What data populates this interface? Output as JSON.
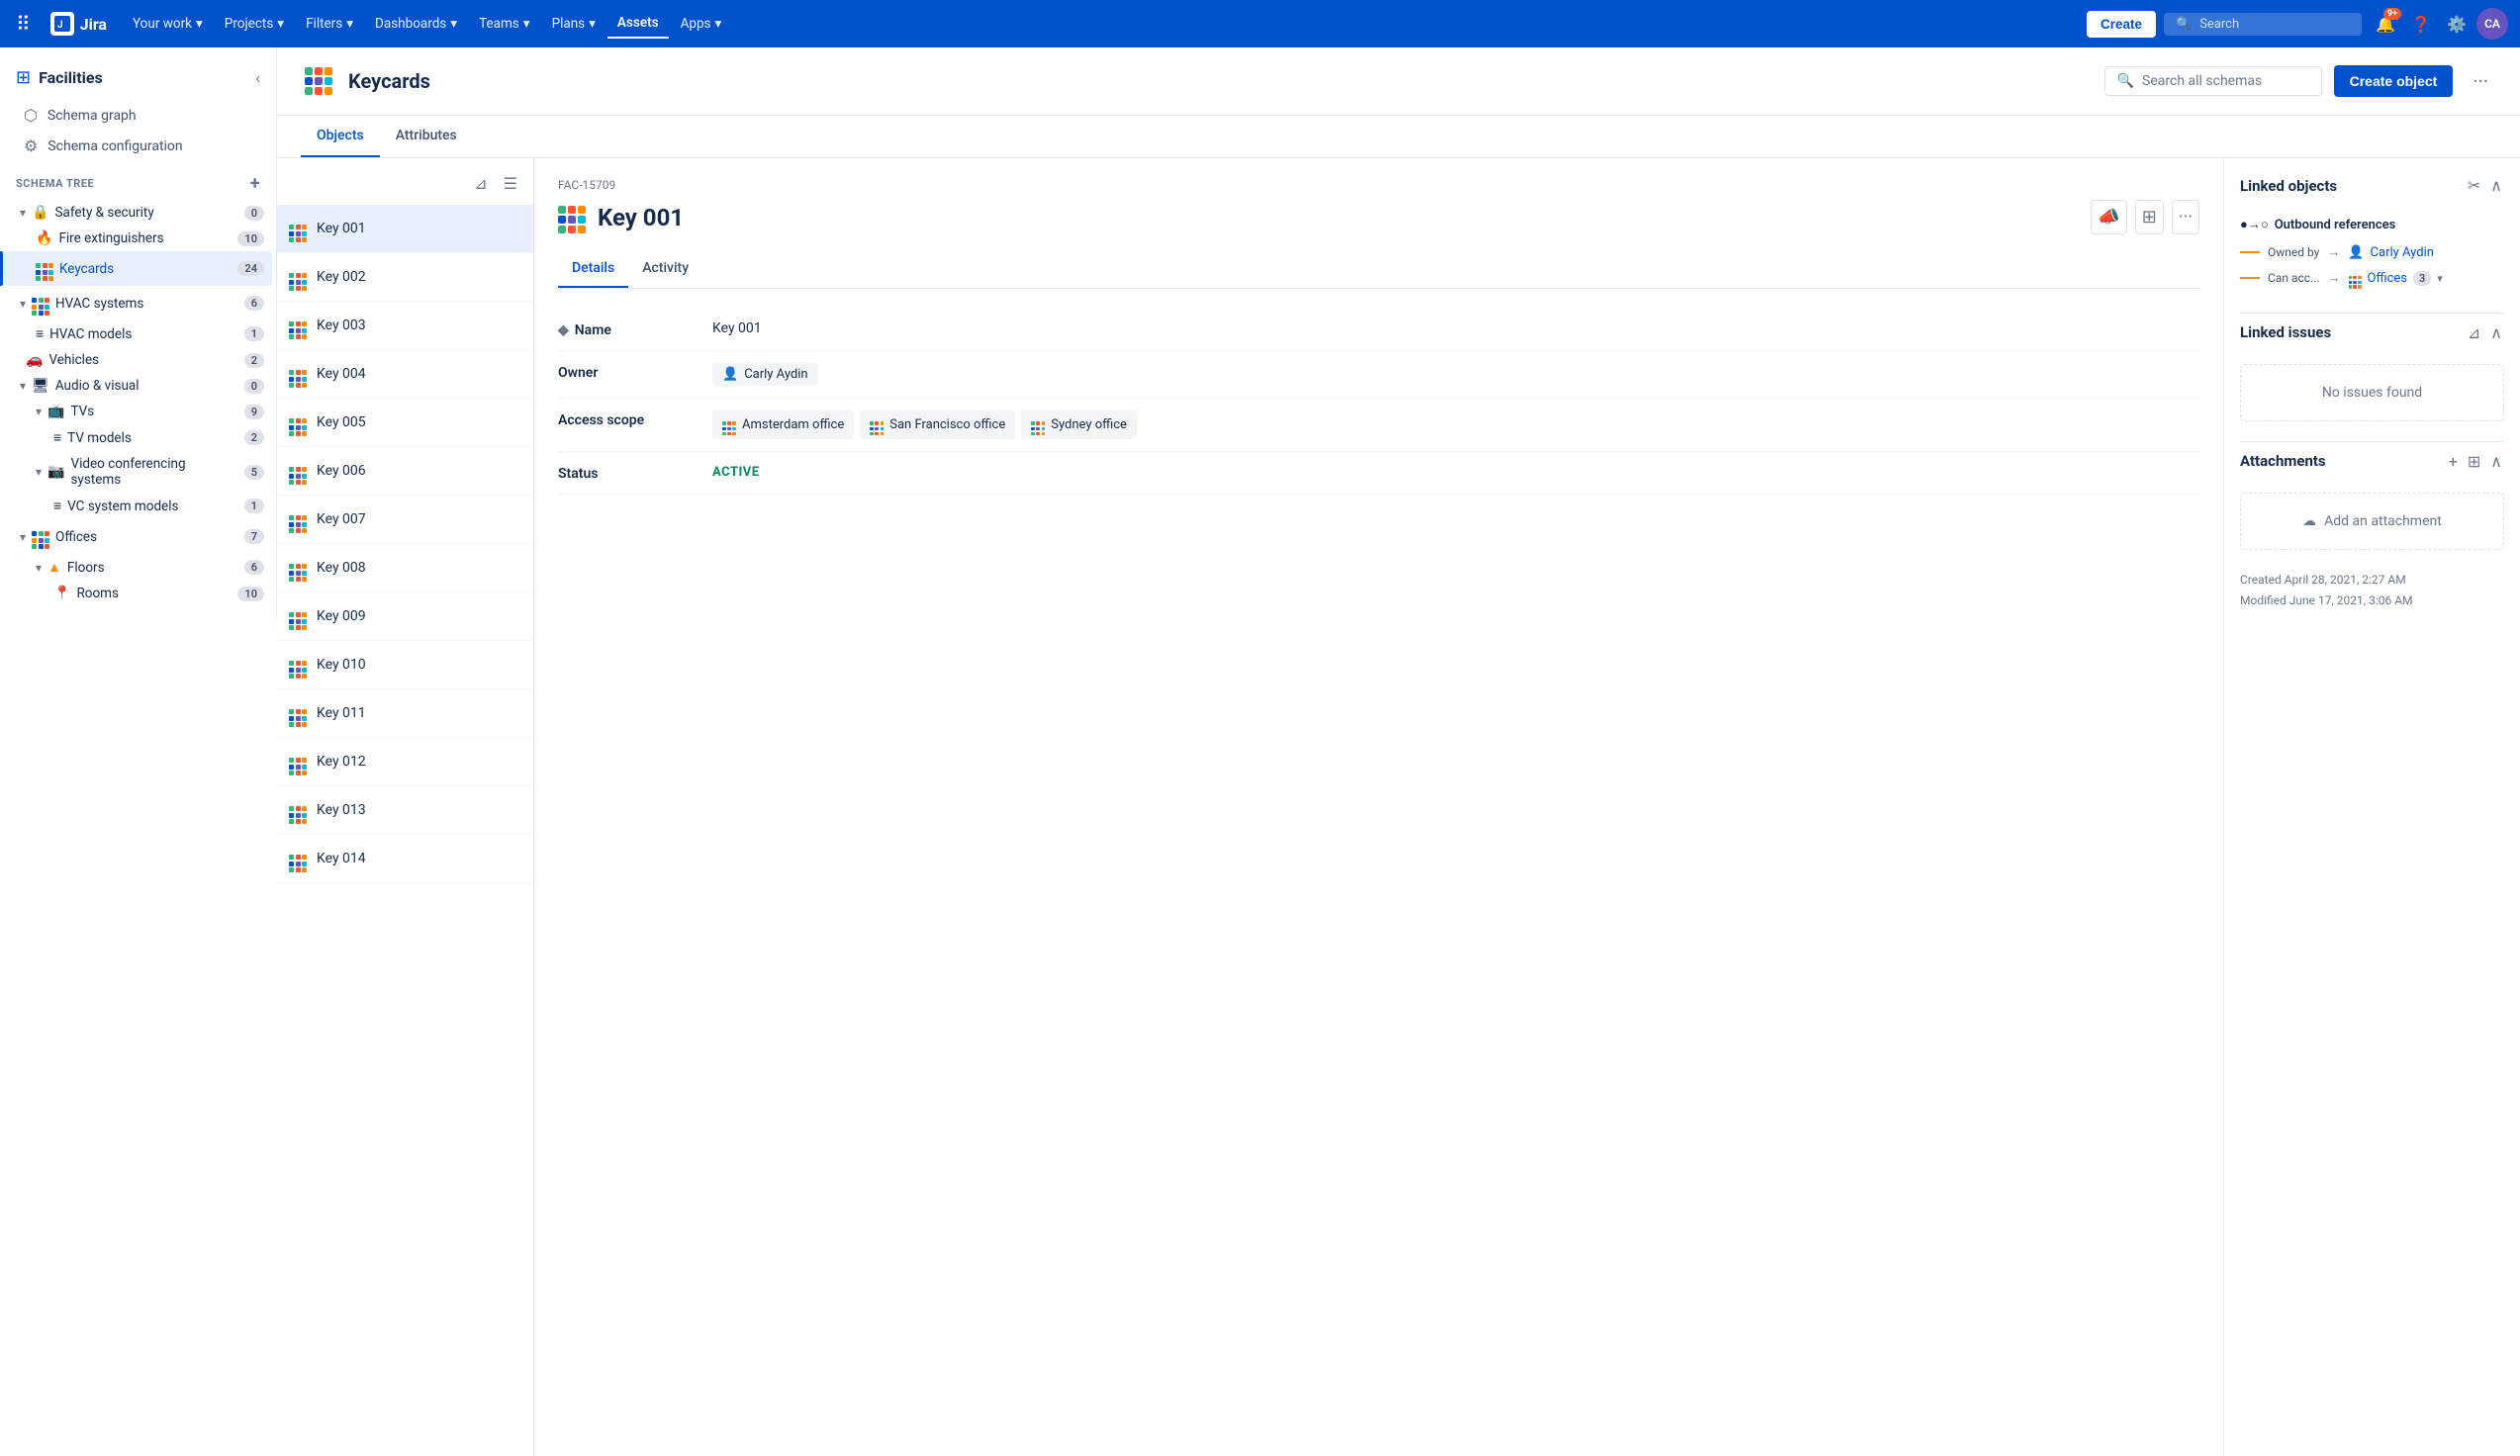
{
  "topnav": {
    "logo_text": "Jira",
    "nav_items": [
      {
        "label": "Your work",
        "has_chevron": true,
        "active": false
      },
      {
        "label": "Projects",
        "has_chevron": true,
        "active": false
      },
      {
        "label": "Filters",
        "has_chevron": true,
        "active": false
      },
      {
        "label": "Dashboards",
        "has_chevron": true,
        "active": false
      },
      {
        "label": "Teams",
        "has_chevron": true,
        "active": false
      },
      {
        "label": "Plans",
        "has_chevron": true,
        "active": false
      },
      {
        "label": "Assets",
        "has_chevron": false,
        "active": true
      },
      {
        "label": "Apps",
        "has_chevron": true,
        "active": false
      }
    ],
    "create_label": "Create",
    "search_placeholder": "Search",
    "notification_count": "9+",
    "avatar_initials": "CA"
  },
  "sidebar": {
    "title": "Facilities",
    "nav_items": [
      {
        "label": "Schema graph",
        "icon": "⬡"
      },
      {
        "label": "Schema configuration",
        "icon": "⚙"
      }
    ],
    "schema_tree_label": "SCHEMA TREE",
    "tree_items": [
      {
        "label": "Safety & security",
        "indent": 0,
        "count": "0",
        "chevron": "down",
        "icon": "lock",
        "active": false
      },
      {
        "label": "Fire extinguishers",
        "indent": 1,
        "count": "10",
        "icon": "fire",
        "active": false
      },
      {
        "label": "Keycards",
        "indent": 1,
        "count": "24",
        "icon": "grid",
        "active": true
      },
      {
        "label": "HVAC systems",
        "indent": 0,
        "count": "6",
        "chevron": "down",
        "icon": "grid-blue",
        "active": false
      },
      {
        "label": "HVAC models",
        "indent": 1,
        "count": "1",
        "icon": "list",
        "active": false
      },
      {
        "label": "Vehicles",
        "indent": 0,
        "count": "2",
        "chevron": "none",
        "icon": "car",
        "active": false
      },
      {
        "label": "Audio & visual",
        "indent": 0,
        "count": "0",
        "chevron": "down",
        "icon": "monitor",
        "active": false
      },
      {
        "label": "TVs",
        "indent": 1,
        "count": "9",
        "chevron": "down",
        "icon": "tv",
        "active": false
      },
      {
        "label": "TV models",
        "indent": 2,
        "count": "2",
        "icon": "list",
        "active": false
      },
      {
        "label": "Video conferencing systems",
        "indent": 1,
        "count": "5",
        "chevron": "down",
        "icon": "camera",
        "active": false
      },
      {
        "label": "VC system models",
        "indent": 2,
        "count": "1",
        "icon": "list",
        "active": false
      },
      {
        "label": "Offices",
        "indent": 0,
        "count": "7",
        "chevron": "down",
        "icon": "grid-blue",
        "active": false
      },
      {
        "label": "Floors",
        "indent": 1,
        "count": "6",
        "chevron": "down",
        "icon": "triangle",
        "active": false
      },
      {
        "label": "Rooms",
        "indent": 2,
        "count": "10",
        "icon": "pin",
        "active": false
      }
    ]
  },
  "content_header": {
    "title": "Keycards",
    "search_placeholder": "Search all schemas",
    "create_button": "Create object",
    "tabs": [
      "Objects",
      "Attributes"
    ],
    "active_tab": "Objects"
  },
  "object_list": {
    "items": [
      {
        "label": "Key 001",
        "active": true
      },
      {
        "label": "Key 002"
      },
      {
        "label": "Key 003"
      },
      {
        "label": "Key 004"
      },
      {
        "label": "Key 005"
      },
      {
        "label": "Key 006"
      },
      {
        "label": "Key 007"
      },
      {
        "label": "Key 008"
      },
      {
        "label": "Key 009"
      },
      {
        "label": "Key 010"
      },
      {
        "label": "Key 011"
      },
      {
        "label": "Key 012"
      },
      {
        "label": "Key 013"
      },
      {
        "label": "Key 014"
      }
    ]
  },
  "detail": {
    "object_id": "FAC-15709",
    "title": "Key 001",
    "tabs": [
      "Details",
      "Activity"
    ],
    "active_tab": "Details",
    "fields": [
      {
        "label": "Name",
        "value": "Key 001",
        "type": "text"
      },
      {
        "label": "Owner",
        "value": "Carly Aydin",
        "type": "person"
      },
      {
        "label": "Access scope",
        "type": "tags",
        "tags": [
          "Amsterdam office",
          "San Francisco office",
          "Sydney office"
        ]
      },
      {
        "label": "Status",
        "value": "ACTIVE",
        "type": "status"
      }
    ]
  },
  "right_panel": {
    "linked_objects": {
      "title": "Linked objects",
      "outbound_label": "Outbound references",
      "refs": [
        {
          "type": "Owned by",
          "target_name": "Carly Aydin",
          "target_type": "person"
        },
        {
          "type": "Can acc...",
          "target_name": "Offices",
          "target_count": "3",
          "target_type": "offices"
        }
      ]
    },
    "linked_issues": {
      "title": "Linked issues",
      "empty_message": "No issues found"
    },
    "attachments": {
      "title": "Attachments",
      "add_label": "Add an attachment"
    },
    "meta": {
      "created": "Created April 28, 2021, 2:27 AM",
      "modified": "Modified June 17, 2021, 3:06 AM"
    }
  }
}
